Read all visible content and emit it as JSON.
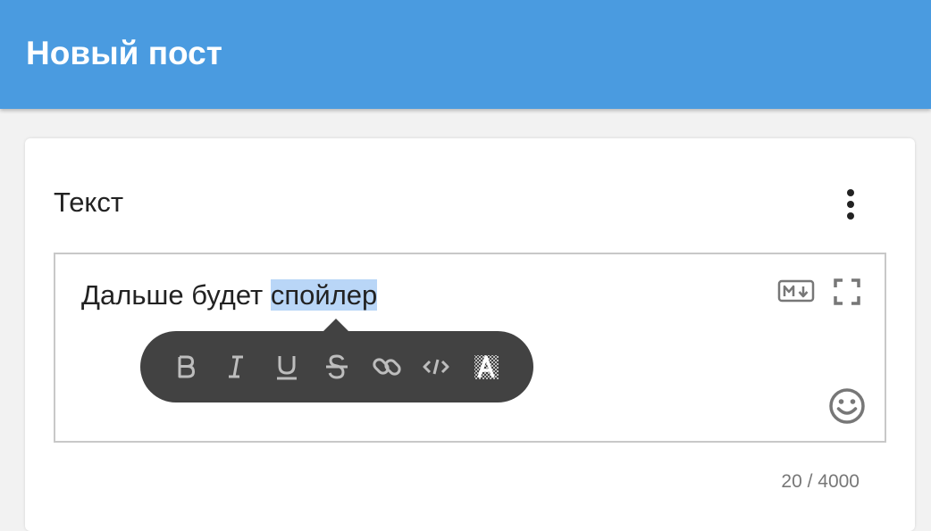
{
  "appbar": {
    "title": "Новый пост",
    "color": "#4a9be0"
  },
  "card": {
    "title": "Текст",
    "menu_icon": "more-vertical-icon"
  },
  "editor": {
    "text_before": "Дальше будет ",
    "text_selected": "спойлер",
    "markdown_icon": "markdown-icon",
    "fullscreen_icon": "fullscreen-icon",
    "emoji_icon": "emoji-smile-icon",
    "selection_color": "#b9d6f7"
  },
  "format_toolbar": {
    "buttons": [
      {
        "name": "bold",
        "icon": "bold-icon"
      },
      {
        "name": "italic",
        "icon": "italic-icon"
      },
      {
        "name": "underline",
        "icon": "underline-icon"
      },
      {
        "name": "strikethrough",
        "icon": "strikethrough-icon"
      },
      {
        "name": "link",
        "icon": "link-icon"
      },
      {
        "name": "code",
        "icon": "code-icon"
      },
      {
        "name": "spoiler",
        "icon": "spoiler-icon"
      }
    ]
  },
  "counter": {
    "text": "20 / 4000"
  }
}
